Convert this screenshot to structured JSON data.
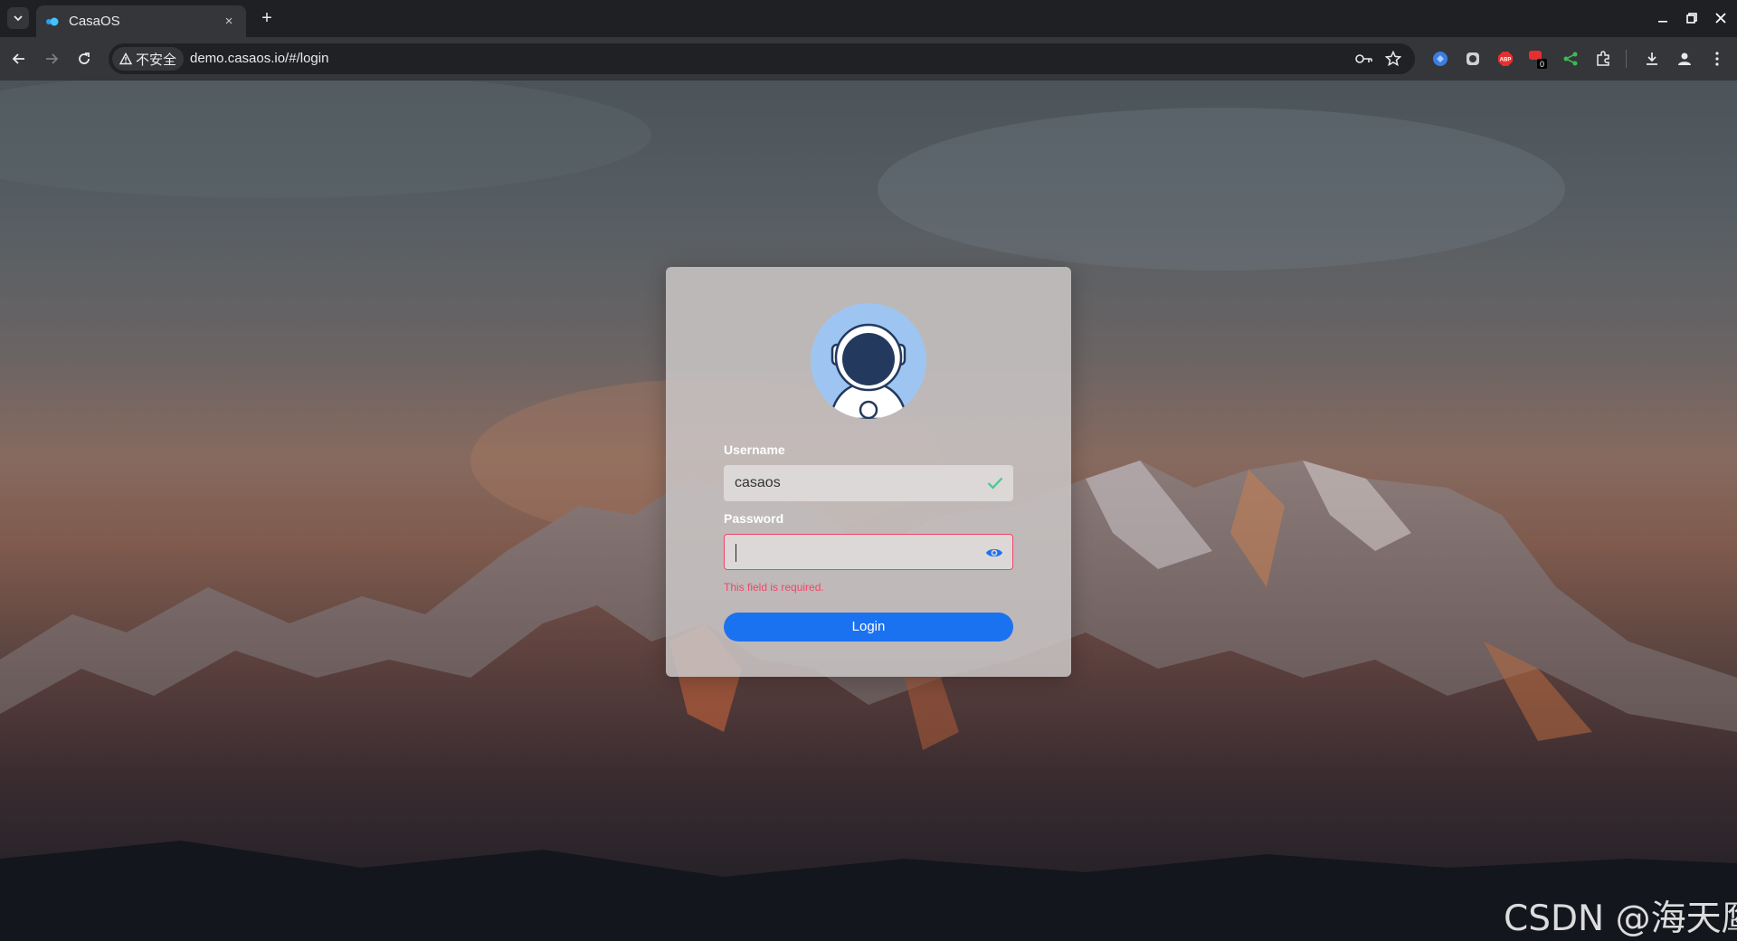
{
  "browser": {
    "tab_title": "CasaOS",
    "tab_close": "×",
    "new_tab": "+",
    "security_label": "不安全",
    "url": "demo.casaos.io/#/login",
    "extension_badge": "0"
  },
  "login": {
    "username_label": "Username",
    "username_value": "casaos",
    "password_label": "Password",
    "password_value": "",
    "password_error": "This field is required.",
    "login_button": "Login"
  },
  "watermark": "CSDN @海天鹰",
  "colors": {
    "accent": "#1b72f0",
    "error": "#f14668",
    "valid": "#48c78e"
  },
  "icons": {
    "username_status": "check-icon",
    "password_toggle": "eye-icon"
  }
}
